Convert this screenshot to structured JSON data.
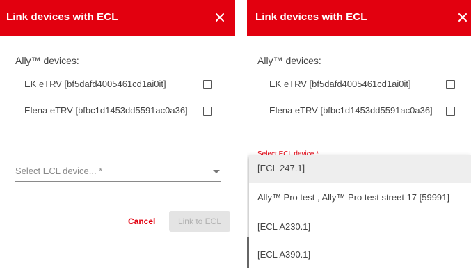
{
  "left_dialog": {
    "title": "Link devices with ECL",
    "close_icon": "close-icon",
    "section_label": "Ally™ devices:",
    "devices": [
      {
        "name": "EK eTRV [bf5dafd4005461cd1ai0it]",
        "checked": false
      },
      {
        "name": "Elena eTRV [bfbc1d1453dd5591ac0a36]",
        "checked": false
      }
    ],
    "select": {
      "placeholder": "Select ECL device... *",
      "arrow_icon": "dropdown-arrow-icon"
    },
    "cancel_label": "Cancel",
    "link_label": "Link to ECL"
  },
  "right_dialog": {
    "title": "Link devices with ECL",
    "close_icon": "close-icon",
    "section_label": "Ally™ devices:",
    "devices": [
      {
        "name": "EK eTRV [bf5dafd4005461cd1ai0it]",
        "checked": false
      },
      {
        "name": "Elena eTRV [bfbc1d1453dd5591ac0a36]",
        "checked": false
      }
    ],
    "floating_label": "Select ECL device *",
    "dropdown_options": [
      {
        "label": "[ECL 247.1]",
        "selected": true
      },
      {
        "label": "Ally™ Pro test , Ally™ Pro test street 17 [59991]",
        "selected": false
      },
      {
        "label": "[ECL A230.1]",
        "selected": false
      },
      {
        "label": "[ECL A390.1]",
        "selected": false
      }
    ]
  },
  "colors": {
    "brand_red": "#e2000f",
    "disabled_button_bg": "#e4e4e4",
    "disabled_button_text": "#b0b0b0",
    "selected_option_bg": "#eeeeee"
  }
}
